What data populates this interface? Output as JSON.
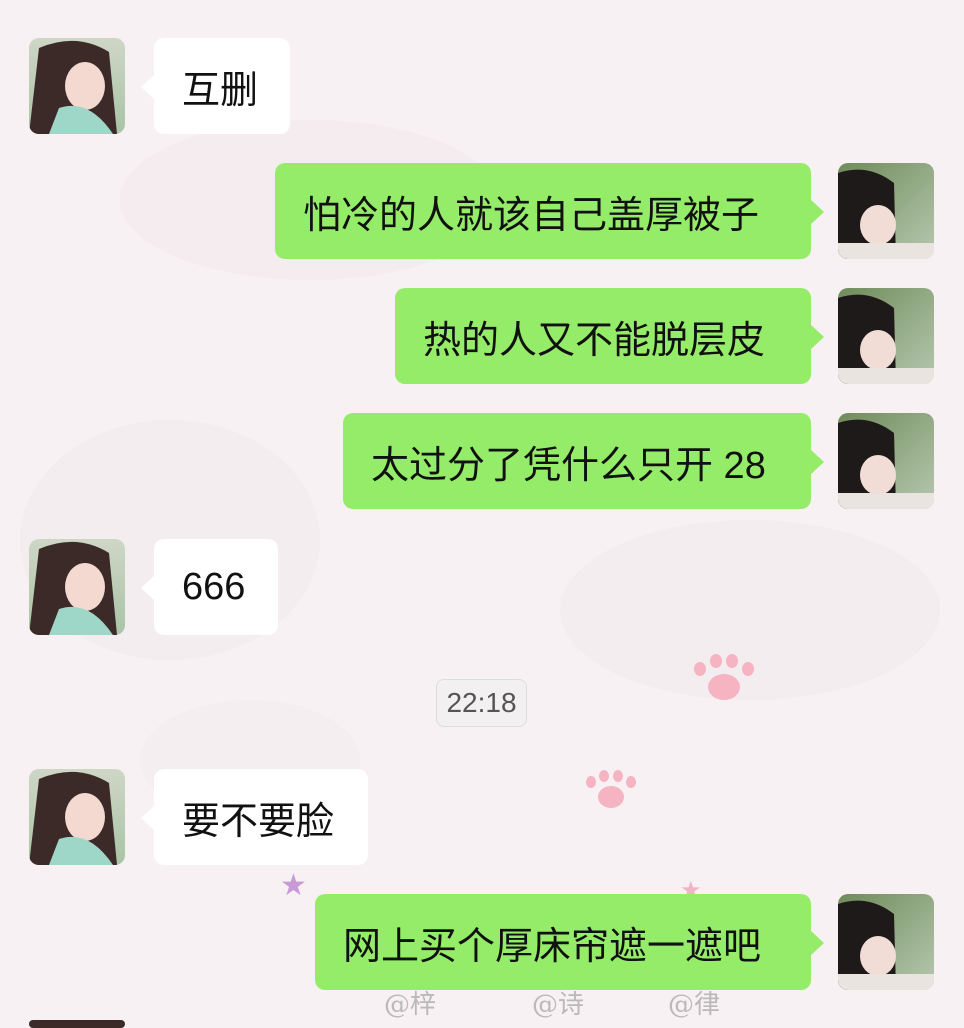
{
  "colors": {
    "outgoing_bubble": "#95ec69",
    "incoming_bubble": "#ffffff",
    "background": "#f7f1f3"
  },
  "wallpaper": {
    "signatures": [
      "@梓",
      "@诗",
      "@律"
    ]
  },
  "messages": [
    {
      "side": "incoming",
      "text": "互删"
    },
    {
      "side": "outgoing",
      "text": "怕冷的人就该自己盖厚被子"
    },
    {
      "side": "outgoing",
      "text": "热的人又不能脱层皮"
    },
    {
      "side": "outgoing",
      "text": "太过分了凭什么只开 28"
    },
    {
      "side": "incoming",
      "text": "666"
    },
    {
      "side": "incoming",
      "text": "要不要脸"
    },
    {
      "side": "outgoing",
      "text": "网上买个厚床帘遮一遮吧"
    }
  ],
  "timestamp": "22:18"
}
